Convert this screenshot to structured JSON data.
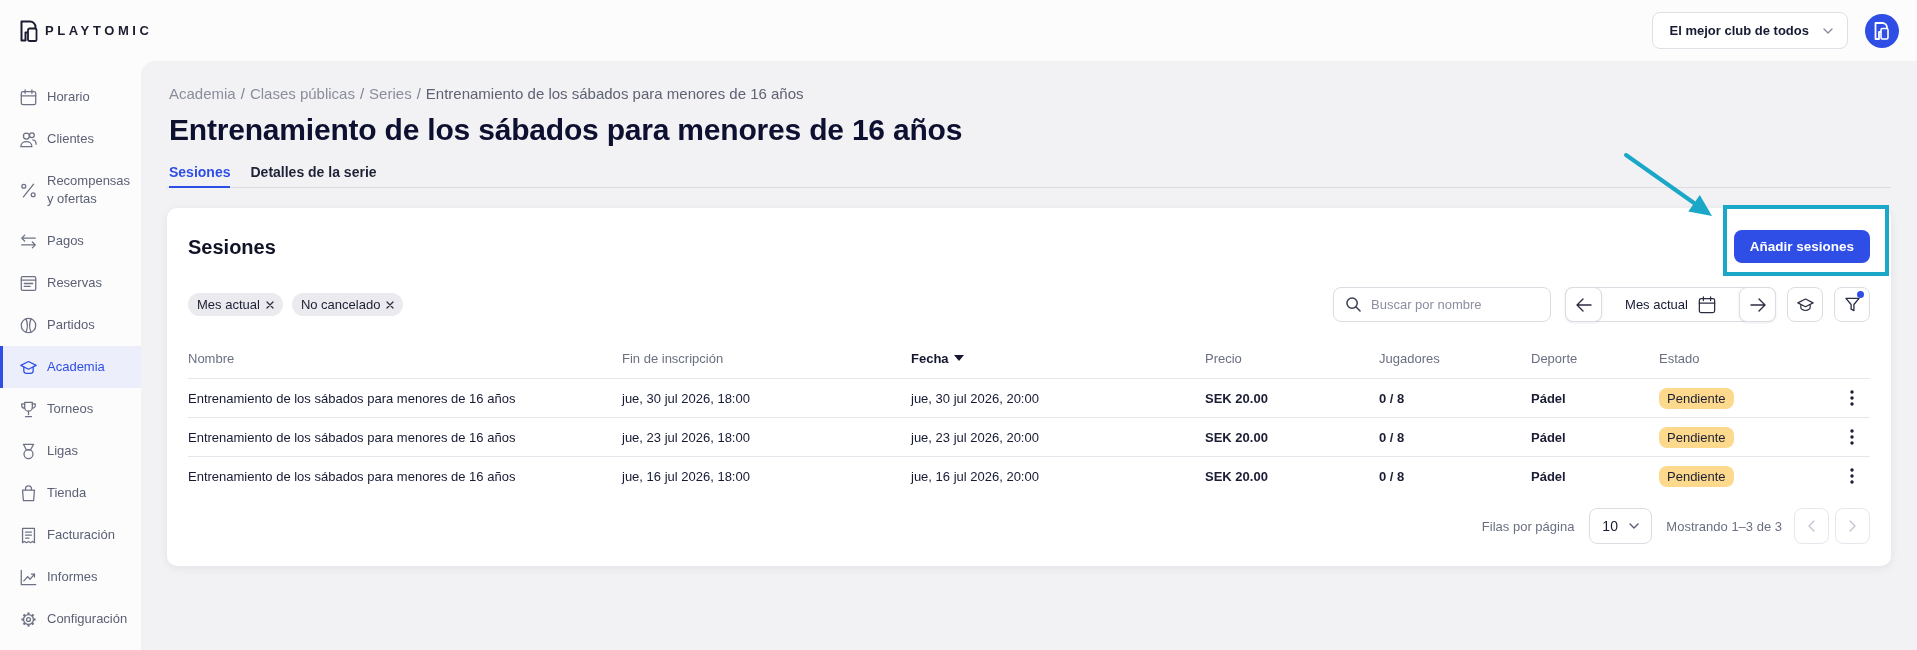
{
  "header": {
    "logo_text": "PLAYTOMIC",
    "club_selector": "El mejor club de todos"
  },
  "sidebar": {
    "items": [
      {
        "label": "Horario",
        "selected": false
      },
      {
        "label": "Clientes",
        "selected": false
      },
      {
        "label": "Recompensas y ofertas",
        "selected": false
      },
      {
        "label": "Pagos",
        "selected": false
      },
      {
        "label": "Reservas",
        "selected": false
      },
      {
        "label": "Partidos",
        "selected": false
      },
      {
        "label": "Academia",
        "selected": true
      },
      {
        "label": "Torneos",
        "selected": false
      },
      {
        "label": "Ligas",
        "selected": false
      },
      {
        "label": "Tienda",
        "selected": false
      },
      {
        "label": "Facturación",
        "selected": false
      },
      {
        "label": "Informes",
        "selected": false
      },
      {
        "label": "Configuración",
        "selected": false
      }
    ]
  },
  "breadcrumb": {
    "items": [
      "Academia",
      "Clases públicas",
      "Series",
      "Entrenamiento de los sábados para menores de 16 años"
    ],
    "separator": "/"
  },
  "title": "Entrenamiento de los sábados para menores de 16 años",
  "tabs": [
    {
      "label": "Sesiones",
      "selected": true
    },
    {
      "label": "Detalles de la serie",
      "selected": false
    }
  ],
  "sessions_card": {
    "title": "Sesiones",
    "add_button": "Añadir sesiones",
    "filter_chips": [
      "Mes actual",
      "No cancelado"
    ],
    "search": {
      "placeholder": "Buscar por nombre"
    },
    "period": {
      "label": "Mes actual"
    },
    "filters_active": true,
    "table": {
      "columns": [
        {
          "label": "Nombre",
          "sorted": false
        },
        {
          "label": "Fin de inscripción",
          "sorted": false
        },
        {
          "label": "Fecha",
          "sorted": true
        },
        {
          "label": "Precio",
          "sorted": false
        },
        {
          "label": "Jugadores",
          "sorted": false
        },
        {
          "label": "Deporte",
          "sorted": false
        },
        {
          "label": "Estado",
          "sorted": false
        }
      ],
      "rows": [
        {
          "cells": [
            "Entrenamiento de los sábados para menores de 16 años",
            "jue, 30 jul 2026, 18:00",
            "jue, 30 jul 2026, 20:00",
            "SEK 20.00",
            "0 / 8",
            "Pádel"
          ],
          "status": {
            "label": "Pendiente",
            "color": "#fcd98c"
          }
        },
        {
          "cells": [
            "Entrenamiento de los sábados para menores de 16 años",
            "jue, 23 jul 2026, 18:00",
            "jue, 23 jul 2026, 20:00",
            "SEK 20.00",
            "0 / 8",
            "Pádel"
          ],
          "status": {
            "label": "Pendiente",
            "color": "#fcd98c"
          }
        },
        {
          "cells": [
            "Entrenamiento de los sábados para menores de 16 años",
            "jue, 16 jul 2026, 18:00",
            "jue, 16 jul 2026, 20:00",
            "SEK 20.00",
            "0 / 8",
            "Pádel"
          ],
          "status": {
            "label": "Pendiente",
            "color": "#fcd98c"
          }
        }
      ]
    },
    "pagination": {
      "rows_per_page_label": "Filas por página",
      "rows_per_page": "10",
      "range": "Mostrando 1–3 de 3",
      "previous_disabled": true,
      "next_disabled": true
    }
  }
}
